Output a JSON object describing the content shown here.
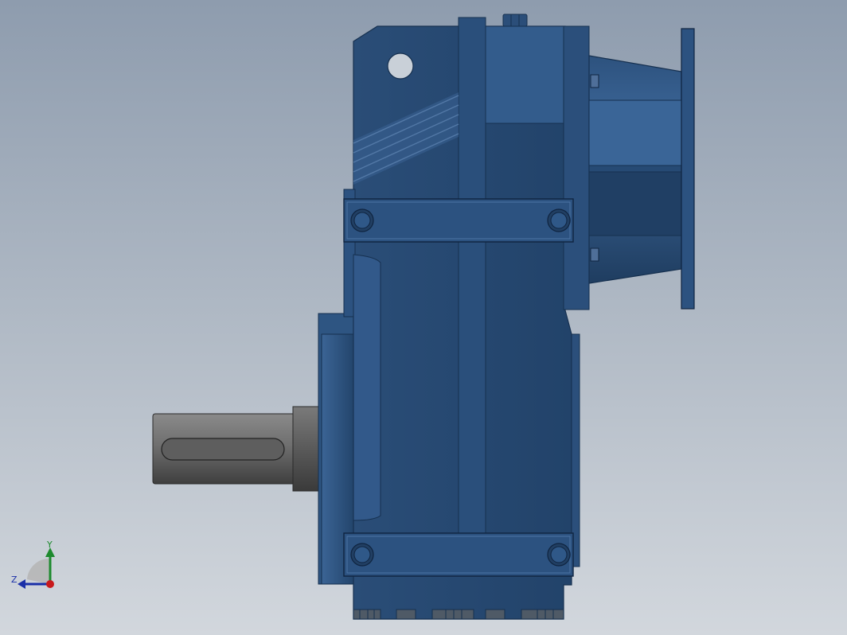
{
  "viewport": {
    "background_top": "#8e9cae",
    "background_bottom": "#d2d7dd"
  },
  "model": {
    "body_color": "#24476f",
    "body_highlight": "#3b6495",
    "shaft_color": "#6b6b6b"
  },
  "triad": {
    "y_label": "Y",
    "z_label": "Z",
    "y_color": "#1d8a2e",
    "z_color": "#1a2fa8",
    "origin_color": "#c8191c"
  }
}
